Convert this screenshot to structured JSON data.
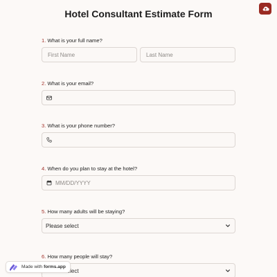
{
  "form": {
    "title": "Hotel Consultant Estimate Form"
  },
  "colors": {
    "accent": "#9a2a22",
    "number": "#a3322b",
    "background": "#fcf9f7",
    "border": "#dcd6d2"
  },
  "questions": [
    {
      "num": "1.",
      "text": "What is your full name?",
      "fields": [
        {
          "placeholder": "First Name"
        },
        {
          "placeholder": "Last Name"
        }
      ]
    },
    {
      "num": "2.",
      "text": "What is your email?",
      "icon": "envelope-icon"
    },
    {
      "num": "3.",
      "text": "What is your phone number?",
      "icon": "phone-icon"
    },
    {
      "num": "4.",
      "text": "When do you plan to stay at the hotel?",
      "icon": "calendar-icon",
      "placeholder": "MM/DD/YYYY"
    },
    {
      "num": "5.",
      "text": "How many adults will be staying?",
      "selected": "Please select"
    },
    {
      "num": "6.",
      "text": "How many people will stay?",
      "selected": "Please select"
    }
  ],
  "badge": {
    "prefix": "Made with",
    "brand": "forms.app"
  },
  "top_button_icon": "cloud-upload-icon"
}
